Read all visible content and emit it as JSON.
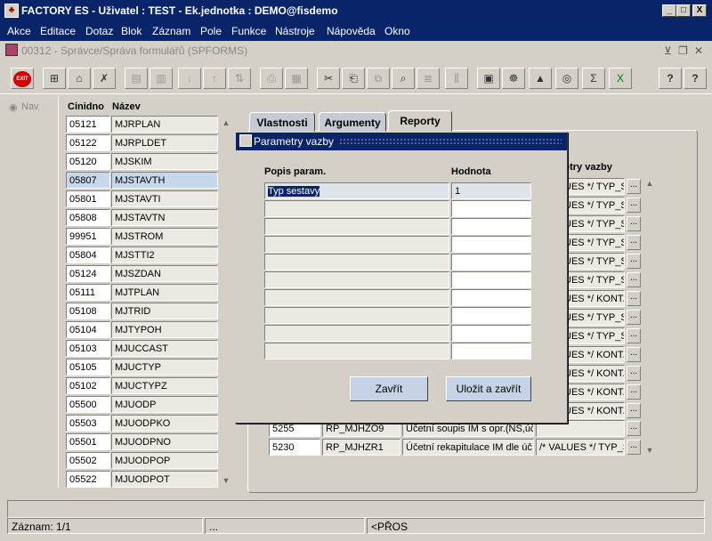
{
  "window": {
    "title": "FACTORY ES - Uživatel : TEST - Ek.jednotka : DEMO@fisdemo",
    "minimize": "_",
    "maximize": "□",
    "close": "X"
  },
  "menu": [
    "Akce",
    "Editace",
    "Dotaz",
    "Blok",
    "Záznam",
    "Pole",
    "Funkce",
    "Nástroje",
    "Nápověda",
    "Okno"
  ],
  "form": {
    "title": "00312 - Správce/Správa formulářů (SPFORMS)"
  },
  "toolbar": {
    "exit_label": "EXIT",
    "help": "?",
    "sigma": "Σ"
  },
  "nav": {
    "label": "Nav"
  },
  "list": {
    "headers": [
      "Cinidno",
      "Název"
    ],
    "rows": [
      [
        "05121",
        "MJRPLAN"
      ],
      [
        "05122",
        "MJRPLDET"
      ],
      [
        "05120",
        "MJSKIM"
      ],
      [
        "05807",
        "MJSTAVTH"
      ],
      [
        "05801",
        "MJSTAVTI"
      ],
      [
        "05808",
        "MJSTAVTN"
      ],
      [
        "99951",
        "MJSTROM"
      ],
      [
        "05804",
        "MJSTTI2"
      ],
      [
        "05124",
        "MJSZDAN"
      ],
      [
        "05111",
        "MJTPLAN"
      ],
      [
        "05108",
        "MJTRID"
      ],
      [
        "05104",
        "MJTYPOH"
      ],
      [
        "05103",
        "MJUCCAST"
      ],
      [
        "05105",
        "MJUCTYP"
      ],
      [
        "05102",
        "MJUCTYPZ"
      ],
      [
        "05500",
        "MJUODP"
      ],
      [
        "05503",
        "MJUODPKO"
      ],
      [
        "05501",
        "MJUODPNO"
      ],
      [
        "05502",
        "MJUODPOP"
      ],
      [
        "05522",
        "MJUODPOT"
      ]
    ],
    "selected_index": 3
  },
  "tabs": [
    "Vlastnosti",
    "Argumenty",
    "Reporty"
  ],
  "reports": {
    "param_header": "etry vazby",
    "param_values": [
      "UES */ TYP_S",
      "UES */ TYP_S",
      "UES */ TYP_S",
      "UES */ TYP_S",
      "UES */ TYP_S",
      "UES */ TYP_S",
      "UES */ KONT.",
      "UES */ TYP_S",
      "UES */ TYP_S",
      "UES */ KONT.",
      "UES */ KONT.",
      "UES */ KONT.",
      "UES */ KONT."
    ],
    "bottom_rows": [
      [
        "5255",
        "RP_MJHZO9",
        "Účetní soupis IM s opr.(NS,úč.",
        ""
      ],
      [
        "5230",
        "RP_MJHZR1",
        "Účetní rekapitulace IM dle úč.ty",
        "/* VALUES */ TYP_S"
      ]
    ],
    "dots": "..."
  },
  "dialog": {
    "title": "Parametry vazby",
    "col_param": "Popis param.",
    "col_value": "Hodnota",
    "rows": [
      {
        "param": "Typ sestavy",
        "value": "1"
      },
      {
        "param": "",
        "value": ""
      },
      {
        "param": "",
        "value": ""
      },
      {
        "param": "",
        "value": ""
      },
      {
        "param": "",
        "value": ""
      },
      {
        "param": "",
        "value": ""
      },
      {
        "param": "",
        "value": ""
      },
      {
        "param": "",
        "value": ""
      },
      {
        "param": "",
        "value": ""
      },
      {
        "param": "",
        "value": ""
      }
    ],
    "close_button": "Zavřít",
    "save_close_button": "Uložit a zavřít"
  },
  "status": {
    "record": "Záznam: 1/1",
    "field2": "...",
    "mode": "<PŘOS"
  }
}
